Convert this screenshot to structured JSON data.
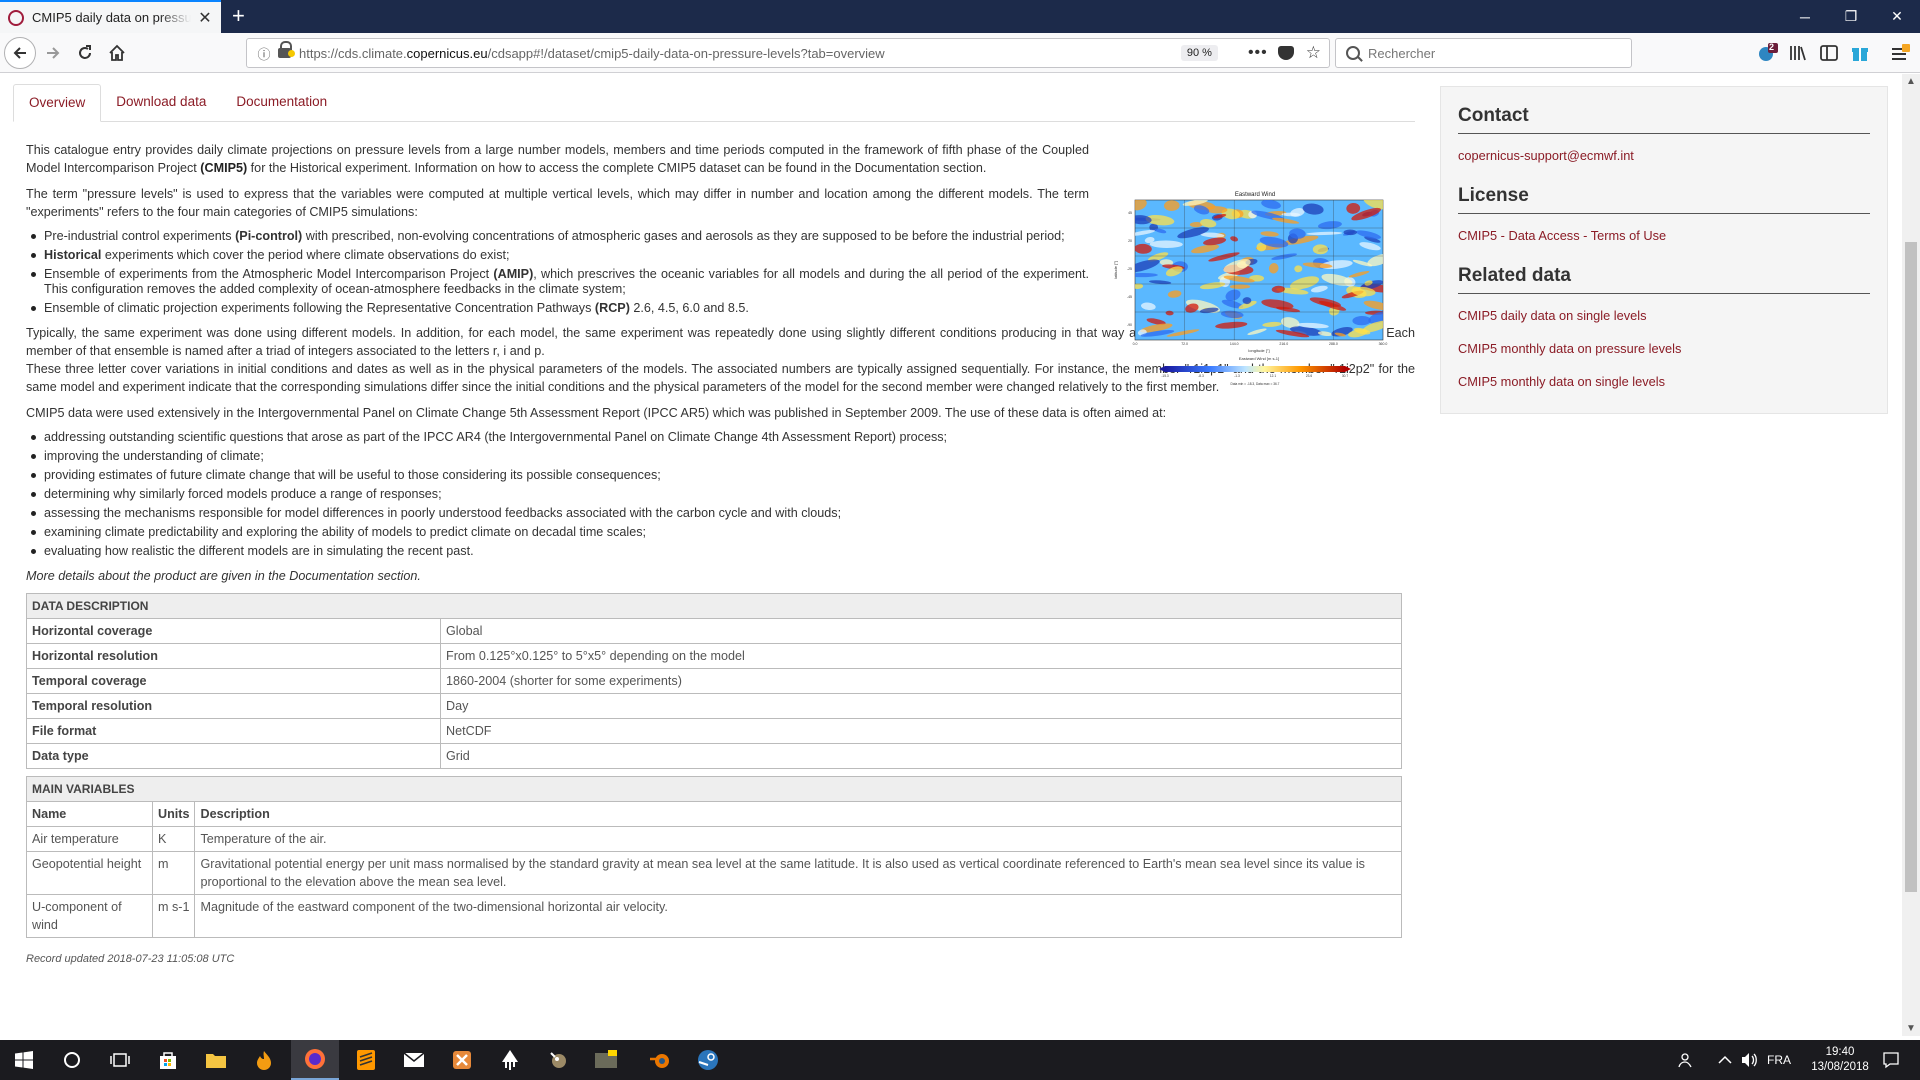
{
  "browser": {
    "tab_title": "CMIP5 daily data on pressure levels",
    "tab_close": "✕",
    "new_tab": "+",
    "url_prefix": "https://cds.climate.",
    "url_domain": "copernicus.eu",
    "url_suffix": "/cdsapp#!/dataset/cmip5-daily-data-on-pressure-levels?tab=overview",
    "zoom": "90 %",
    "more": "•••",
    "search_placeholder": "Rechercher",
    "notif_count": "2",
    "win_minimize": "─",
    "win_restore": "❐",
    "win_close": "✕"
  },
  "tabs": [
    {
      "label": "Overview",
      "active": true
    },
    {
      "label": "Download data",
      "active": false
    },
    {
      "label": "Documentation",
      "active": false
    }
  ],
  "overview": {
    "p1_a": "This catalogue entry provides daily climate projections on pressure levels from a large number models, members and time periods computed in the framework of fifth phase of the Coupled Model Intercomparison Project ",
    "p1_b": "(CMIP5)",
    "p1_c": " for the Historical experiment. Information on how to access the complete CMIP5 dataset can be found in the Documentation section.",
    "p2": "The term \"pressure levels\" is used to express that the variables were computed at multiple vertical levels, which may differ in number and location among the different models. The term \"experiments\" refers to the four main categories of CMIP5 simulations:",
    "exp1_a": "Pre-industrial control experiments ",
    "exp1_b": "(Pi-control)",
    "exp1_c": " with prescribed, non-evolving concentrations of atmospheric gases and aerosols as they are supposed to be before the industrial period;",
    "exp2_a": "Historical",
    "exp2_b": " experiments which cover the period where climate observations do exist;",
    "exp3_a": "Ensemble of experiments from the Atmospheric Model Intercomparison Project ",
    "exp3_b": "(AMIP)",
    "exp3_c": ", which prescrives the oceanic variables for all models and during the all period of the experiment. This configuration removes the added complexity of ocean-atmosphere feedbacks in the climate system;",
    "exp4_a": "Ensemble of climatic projection experiments following the Representative Concentration Pathways ",
    "exp4_b": "(RCP)",
    "exp4_c": " 2.6, 4.5, 6.0 and 8.5.",
    "p3": "Typically, the same experiment was done using different models. In addition, for each model, the same experiment was repeatedly done using slightly different conditions producing in that way an ensemble of experiments closely related. Each member of that ensemble is named after a triad of integers associated to the letters r, i and p.",
    "p4": "These three letter cover variations in initial conditions and dates as well as in the physical parameters of the models. The associated numbers are typically assigned sequentially. For instance, the member \"r1i1p1\" and the member \"r1i2p2\" for the same model and experiment indicate that the corresponding simulations differ since the initial conditions and the physical parameters of the model for the second member were changed relatively to the first member.",
    "p5": "CMIP5 data were used extensively in the Intergovernmental Panel on Climate Change 5th Assessment Report (IPCC AR5) which was published in September 2009. The use of these data is often aimed at:",
    "uses": [
      "addressing outstanding scientific questions that arose as part of the IPCC AR4 (the Intergovernmental Panel on Climate Change 4th Assessment Report) process;",
      "improving the understanding of climate;",
      "providing estimates of future climate change that will be useful to those considering its possible consequences;",
      "determining why similarly forced models produce a range of responses;",
      "assessing the mechanisms responsible for model differences in poorly understood feedbacks associated with the carbon cycle and with clouds;",
      "examining climate predictability and exploring the ability of models to predict climate on decadal time scales;",
      "evaluating how realistic the different models are in simulating the recent past."
    ],
    "more_details": "More details about the product are given in the Documentation section."
  },
  "thumbnail": {
    "title": "Eastward Wind",
    "ylabel": "latitude [°]",
    "xlabel": "longitude [°]",
    "colorbar_label": "Eastward Wind [m s-1]",
    "yticks": [
      "45",
      "20",
      "-25",
      "-45",
      "-90"
    ],
    "xticks": [
      "0.0",
      "72.0",
      "144.0",
      "216.0",
      "288.0",
      "360.0"
    ],
    "cticks": [
      "-15.3",
      "-8.3",
      "-1.3",
      "12.1",
      "23.6",
      "30.7"
    ],
    "footnote": "Data min = -18.3, Data max = 36.7"
  },
  "data_description": {
    "header": "DATA DESCRIPTION",
    "rows": [
      {
        "k": "Horizontal coverage",
        "v": "Global"
      },
      {
        "k": "Horizontal resolution",
        "v": "From 0.125°x0.125° to 5°x5° depending on the model"
      },
      {
        "k": "Temporal coverage",
        "v": "1860-2004 (shorter for some experiments)"
      },
      {
        "k": "Temporal resolution",
        "v": "Day"
      },
      {
        "k": "File format",
        "v": "NetCDF"
      },
      {
        "k": "Data type",
        "v": "Grid"
      }
    ]
  },
  "main_variables": {
    "header": "MAIN VARIABLES",
    "col_name": "Name",
    "col_units": "Units",
    "col_desc": "Description",
    "rows": [
      {
        "name": "Air temperature",
        "units": "K",
        "desc": "Temperature of the air."
      },
      {
        "name": "Geopotential height",
        "units": "m",
        "desc": "Gravitational potential energy per unit mass normalised by the standard gravity at mean sea level at the same latitude. It is also used as vertical coordinate referenced to Earth's mean sea level since its value is proportional to the elevation above the mean sea level."
      },
      {
        "name": "U-component of wind",
        "units": "m s-1",
        "desc": "Magnitude of the eastward component of the two-dimensional horizontal air velocity."
      }
    ]
  },
  "record_updated": "Record updated 2018-07-23 11:05:08 UTC",
  "sidebar": {
    "contact_title": "Contact",
    "contact_email": "copernicus-support@ecmwf.int",
    "license_title": "License",
    "license_link": "CMIP5 - Data Access - Terms of Use",
    "related_title": "Related data",
    "related": [
      "CMIP5 daily data on single levels",
      "CMIP5 monthly data on pressure levels",
      "CMIP5 monthly data on single levels"
    ]
  },
  "taskbar": {
    "lang": "FRA",
    "time": "19:40",
    "date": "13/08/2018"
  }
}
